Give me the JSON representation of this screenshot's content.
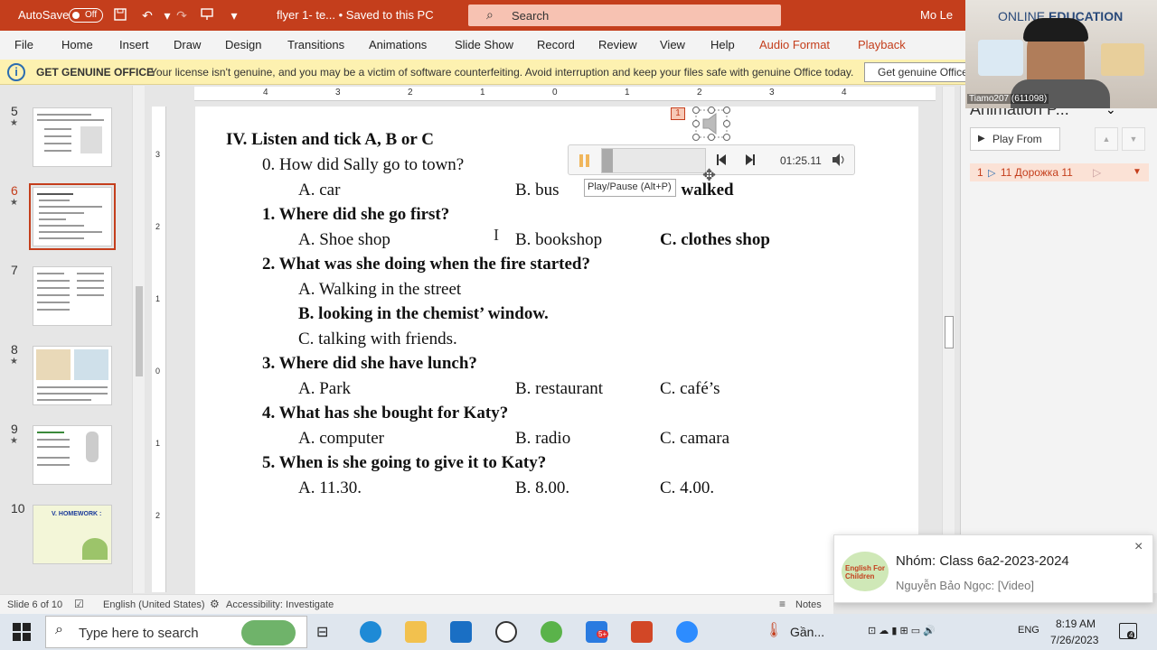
{
  "titlebar": {
    "autosave_label": "AutoSave",
    "autosave_state": "Off",
    "file_title": "flyer 1- te...  •  Saved to this PC",
    "search_placeholder": "Search",
    "user_name": "Mo Le"
  },
  "menu": {
    "items": [
      "File",
      "Home",
      "Insert",
      "Draw",
      "Design",
      "Transitions",
      "Animations",
      "Slide Show",
      "Record",
      "Review",
      "View",
      "Help",
      "Audio Format",
      "Playback"
    ]
  },
  "license": {
    "title": "GET GENUINE OFFICE",
    "message": "Your license isn't genuine, and you may be a victim of software counterfeiting. Avoid interruption and keep your files safe with genuine Office today.",
    "button": "Get genuine Office"
  },
  "thumbnails": [
    {
      "num": "5",
      "star": true
    },
    {
      "num": "6",
      "star": true,
      "selected": true
    },
    {
      "num": "7",
      "star": false
    },
    {
      "num": "8",
      "star": true
    },
    {
      "num": "9",
      "star": true
    },
    {
      "num": "10",
      "star": false,
      "title": "V. HOMEWORK :"
    }
  ],
  "ruler": {
    "h_labels": [
      "4",
      "3",
      "2",
      "1",
      "0",
      "1",
      "2",
      "3",
      "4"
    ],
    "v_labels": [
      "3",
      "2",
      "1",
      "0",
      "1",
      "2"
    ]
  },
  "slide": {
    "heading": "IV. Listen and tick A, B or C",
    "q0": "0. How did Sally go to town?",
    "q0_a": "A. car",
    "q0_b": "B.  bus",
    "q0_c": ".  walked",
    "q1": "1. Where did she go first?",
    "q1_a": "A. Shoe shop",
    "q1_b": "B.   bookshop",
    "q1_c": "C.  clothes shop",
    "q2": "2. What was she doing when the fire started?",
    "q2_a": "A. Walking in the street",
    "q2_b": "B. looking in the chemist’ window.",
    "q2_c": "C. talking with friends.",
    "q3": "3. Where did she have lunch?",
    "q3_a": "A. Park",
    "q3_b": "B. restaurant",
    "q3_c": "C. café’s",
    "q4": "4. What has she bought for Katy?",
    "q4_a": "A. computer",
    "q4_b": "B.   radio",
    "q4_c": "C.  camara",
    "q5": "5. When is she going to give it to Katy?",
    "q5_a": "A. 11.30.",
    "q5_b": "B. 8.00.",
    "q5_c": "C. 4.00."
  },
  "media": {
    "anim_badge": "1",
    "time": "01:25.11",
    "progress": 0.1,
    "tooltip": "Play/Pause (Alt+P)"
  },
  "animation_pane": {
    "title": "Animation P...",
    "play_from": "Play From",
    "item_num": "1",
    "item_label": "11 Дорожка 11"
  },
  "webcam": {
    "brand_light": "ONLINE",
    "brand_bold": "EDUCATION",
    "caption": "Tiamo207 (611098)"
  },
  "notification": {
    "title": "Nhóm: Class 6a2-2023-2024",
    "body": "Nguyễn Bảo Ngọc: [Video]",
    "logo_text": "English For Children"
  },
  "status": {
    "slide": "Slide 6 of 10",
    "language": "English (United States)",
    "accessibility": "Accessibility: Investigate",
    "notes": "Notes"
  },
  "taskbar": {
    "search_placeholder": "Type here to search",
    "weather": "Gần...",
    "lang": "ENG",
    "time": "8:19 AM",
    "date": "7/26/2023",
    "notif_count": "4",
    "zalo_badge": "5+"
  },
  "colors": {
    "accent": "#c43e1c",
    "license_bg": "#fdf1b0"
  }
}
